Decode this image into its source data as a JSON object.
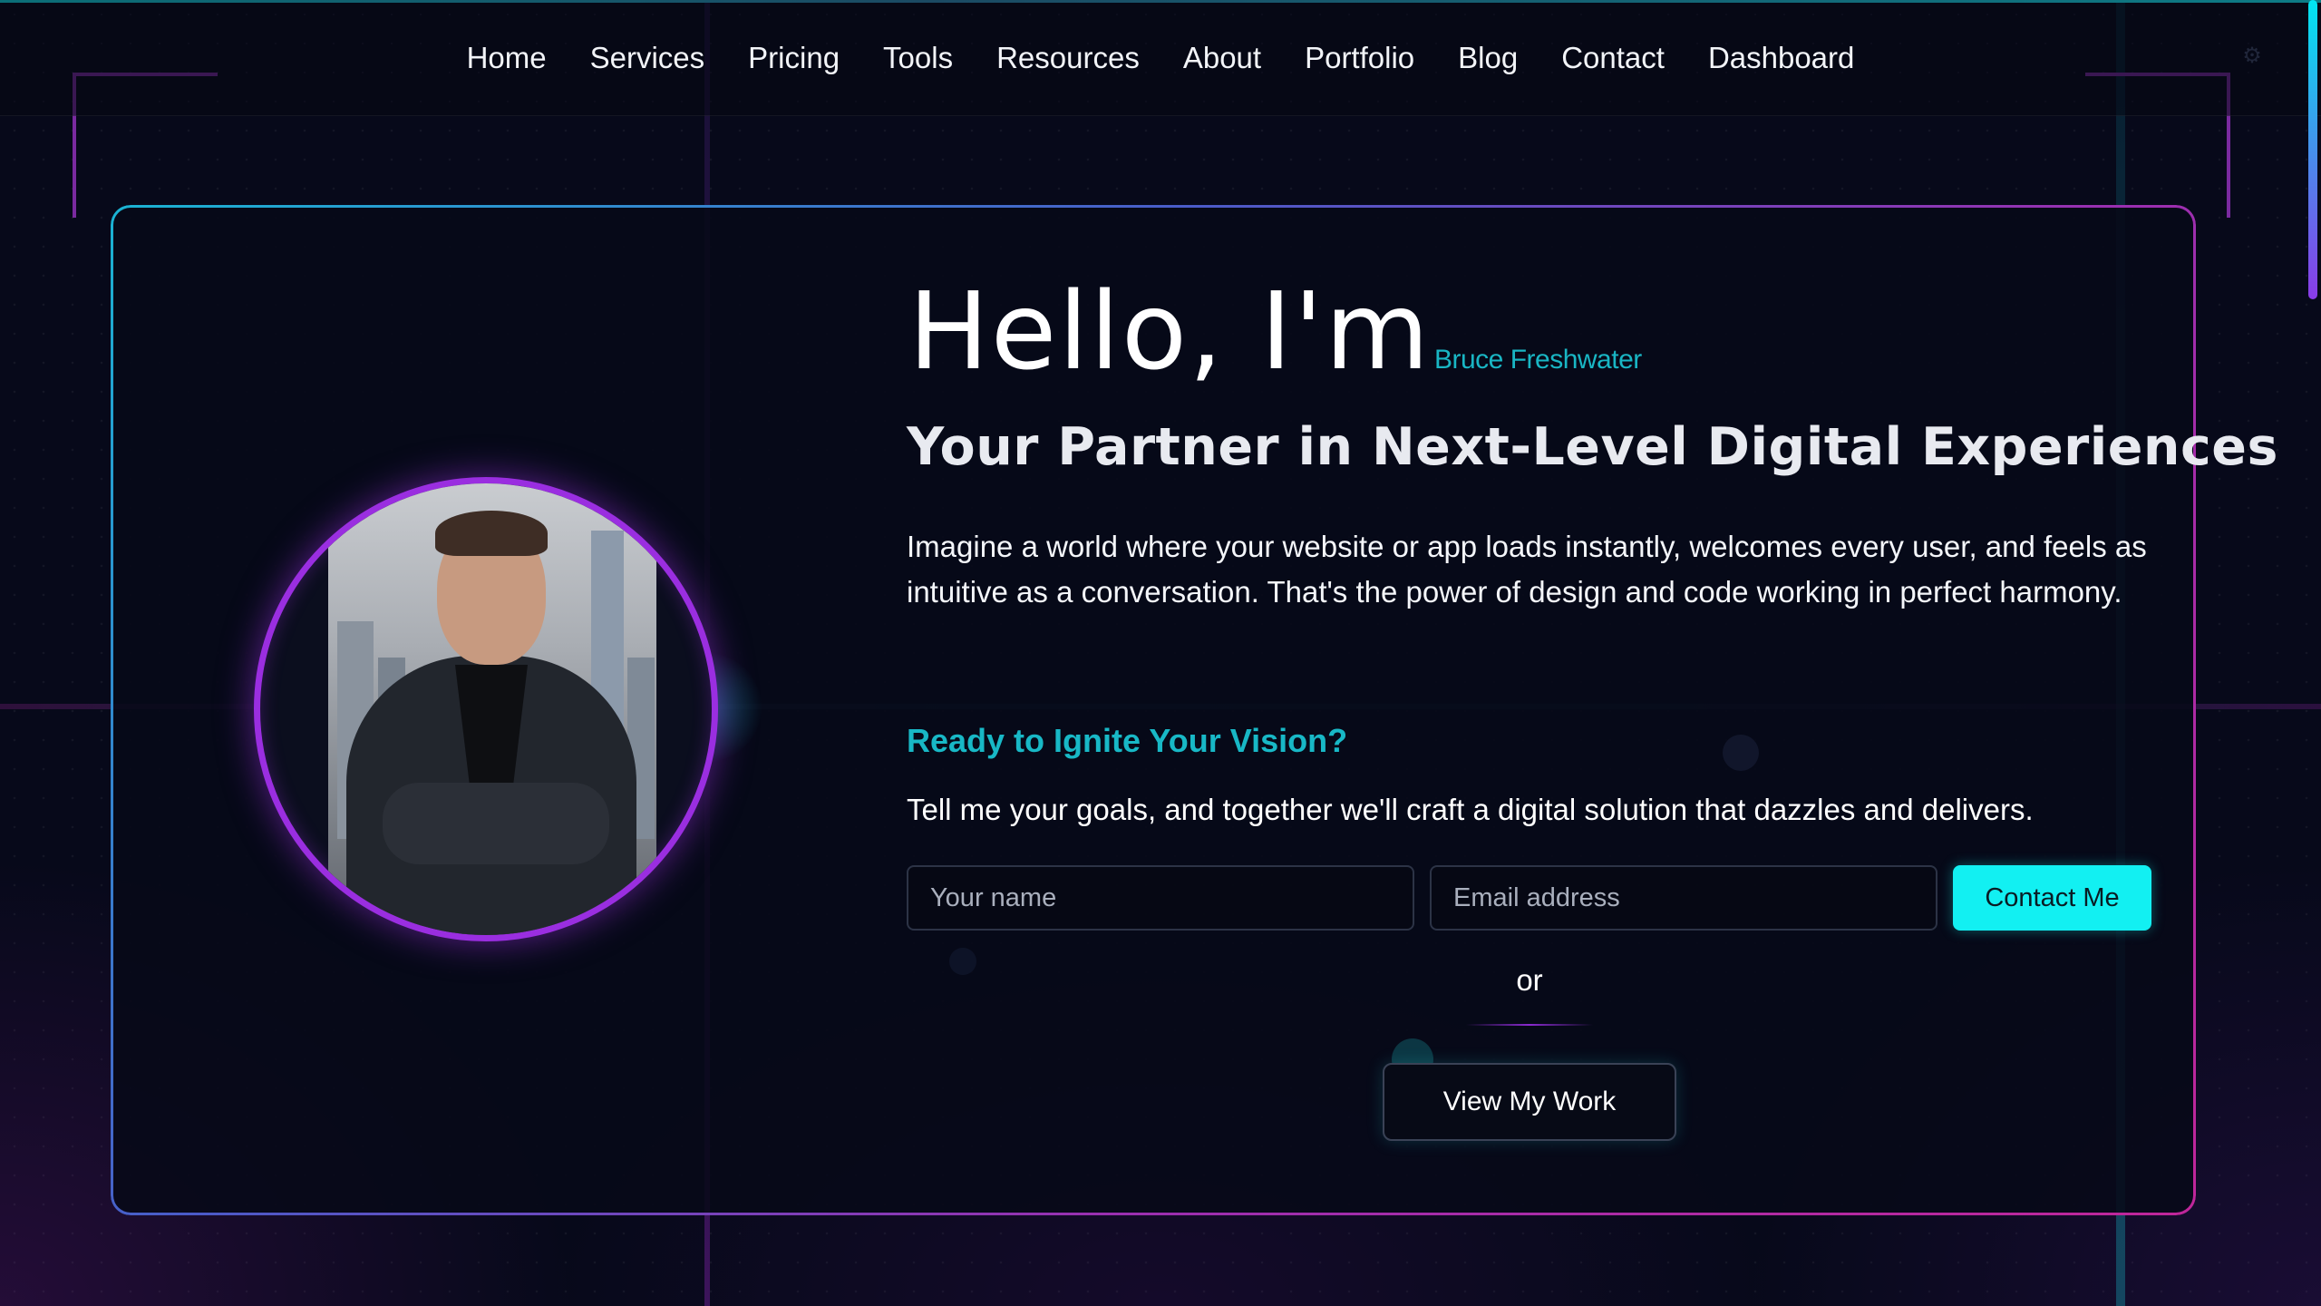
{
  "nav": {
    "items": [
      {
        "label": "Home"
      },
      {
        "label": "Services"
      },
      {
        "label": "Pricing"
      },
      {
        "label": "Tools"
      },
      {
        "label": "Resources"
      },
      {
        "label": "About"
      },
      {
        "label": "Portfolio"
      },
      {
        "label": "Blog"
      },
      {
        "label": "Contact"
      },
      {
        "label": "Dashboard"
      }
    ],
    "settings_icon": "gear-icon"
  },
  "hero": {
    "greeting": "Hello, I'm",
    "name": "Bruce Freshwater",
    "tagline": "Your Partner in Next-Level Digital Experiences",
    "intro": "Imagine a world where your website or app loads instantly, welcomes every user, and feels as intuitive as a conversation. That's the power of design and code working in perfect harmony.",
    "avatar": "profile-photo"
  },
  "contact": {
    "heading": "Ready to Ignite Your Vision?",
    "text": "Tell me your goals, and together we'll craft a digital solution that dazzles and delivers.",
    "name_placeholder": "Your name",
    "email_placeholder": "Email address",
    "submit_label": "Contact Me",
    "separator": "or",
    "portfolio_label": "View My Work"
  },
  "colors": {
    "accent_cyan": "#12f0f2",
    "accent_purple": "#9a2ee0",
    "background": "#07091a"
  }
}
